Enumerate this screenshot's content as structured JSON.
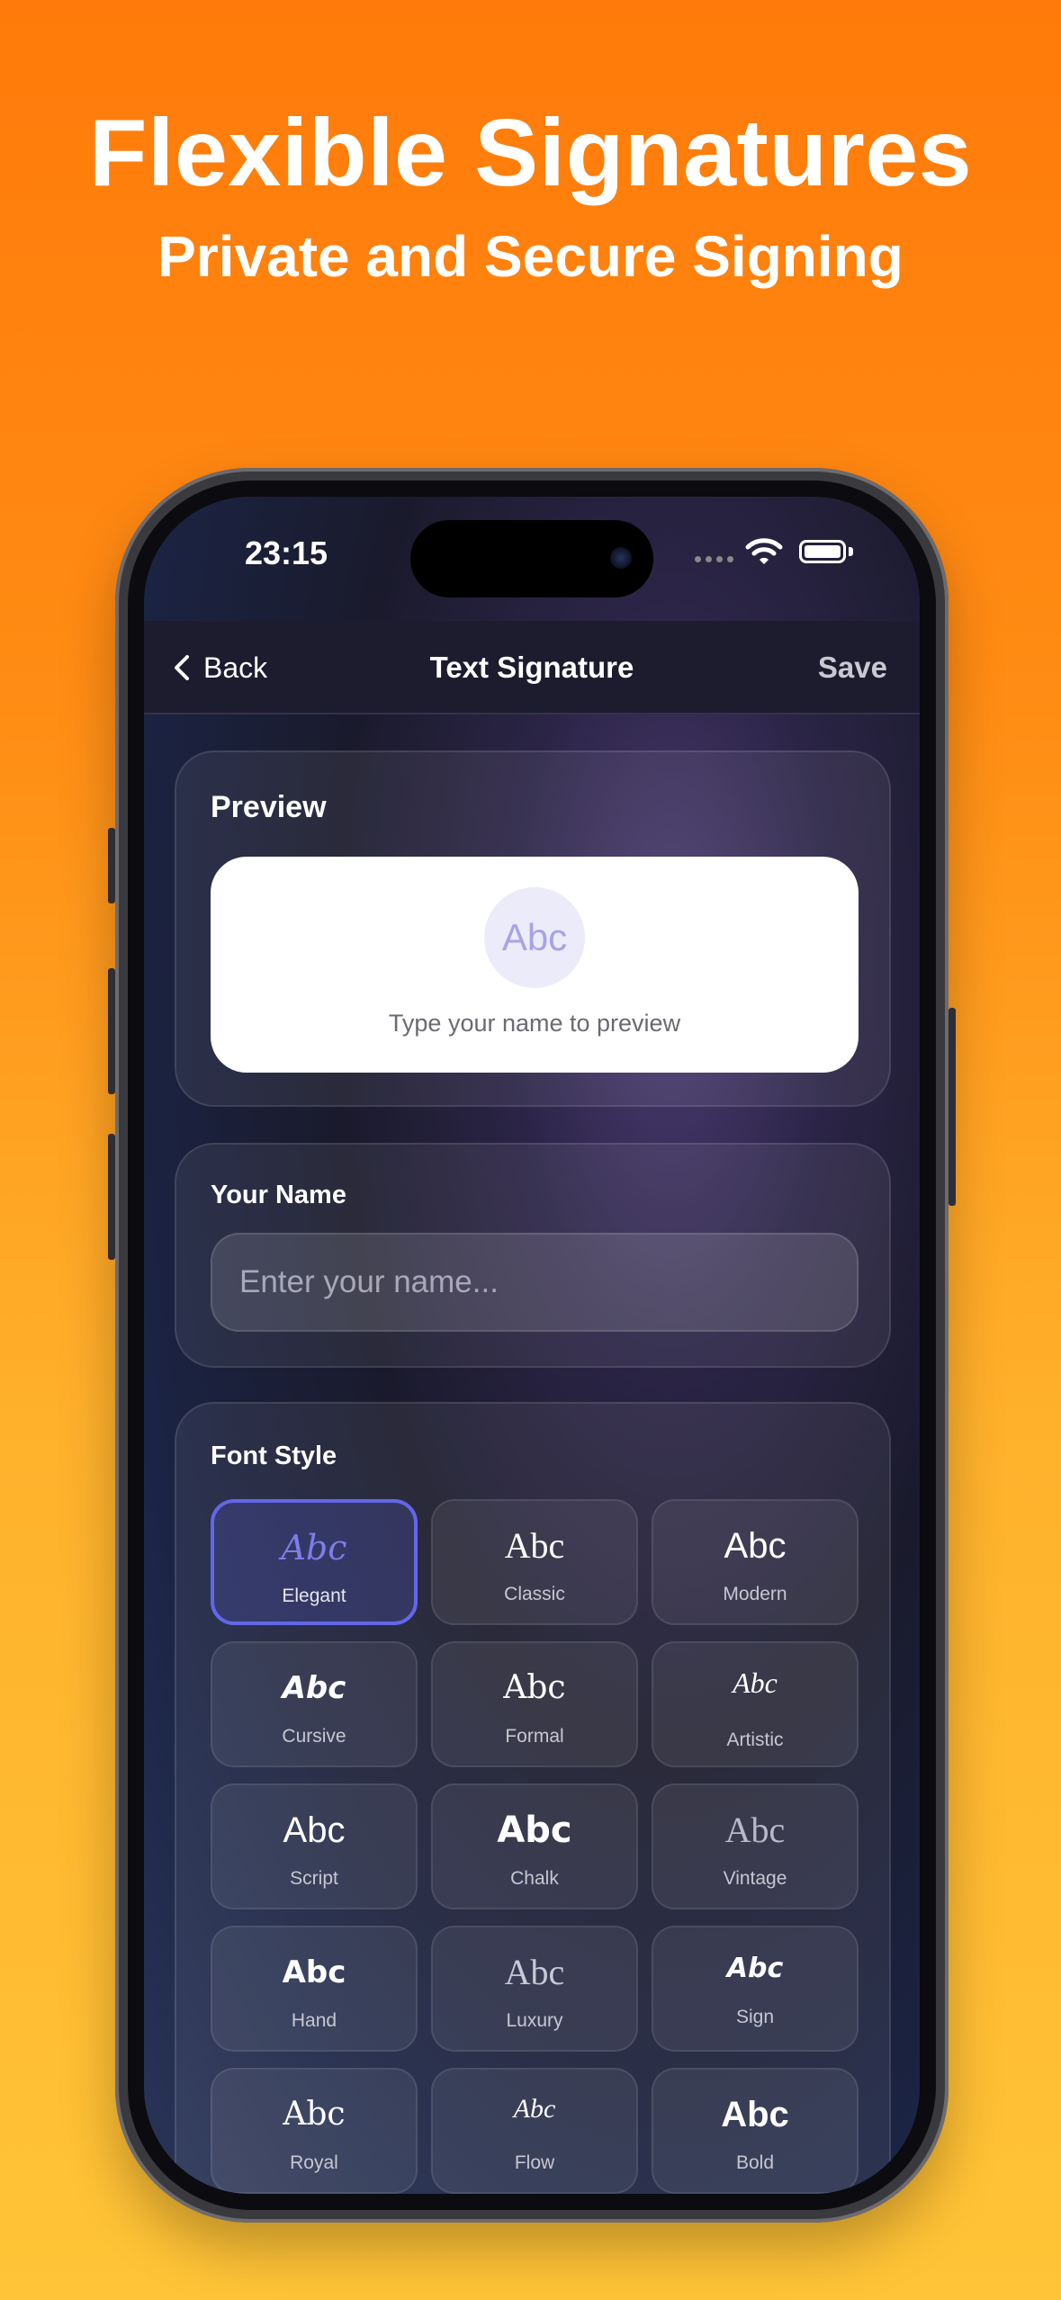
{
  "promo": {
    "headline": "Flexible Signatures",
    "subheadline": "Private and Secure Signing"
  },
  "status_bar": {
    "time": "23:15"
  },
  "nav": {
    "back_label": "Back",
    "title": "Text Signature",
    "save_label": "Save"
  },
  "preview": {
    "section_title": "Preview",
    "placeholder_sample": "Abc",
    "hint": "Type your name to preview"
  },
  "name": {
    "section_title": "Your Name",
    "placeholder": "Enter your name...",
    "value": ""
  },
  "font_style": {
    "section_title": "Font Style",
    "selected": "Elegant",
    "options": [
      {
        "sample": "Abc",
        "name": "Elegant"
      },
      {
        "sample": "Abc",
        "name": "Classic"
      },
      {
        "sample": "Abc",
        "name": "Modern"
      },
      {
        "sample": "Abc",
        "name": "Cursive"
      },
      {
        "sample": "Abc",
        "name": "Formal"
      },
      {
        "sample": "Abc",
        "name": "Artistic"
      },
      {
        "sample": "Abc",
        "name": "Script"
      },
      {
        "sample": "Abc",
        "name": "Chalk"
      },
      {
        "sample": "Abc",
        "name": "Vintage"
      },
      {
        "sample": "Abc",
        "name": "Hand"
      },
      {
        "sample": "Abc",
        "name": "Luxury"
      },
      {
        "sample": "Abc",
        "name": "Sign"
      },
      {
        "sample": "Abc",
        "name": "Royal"
      },
      {
        "sample": "Abc",
        "name": "Flow"
      },
      {
        "sample": "Abc",
        "name": "Bold"
      }
    ]
  },
  "colors": {
    "accent": "#6466e8",
    "background_top": "#ff7a0a",
    "background_bottom": "#ffc437"
  }
}
